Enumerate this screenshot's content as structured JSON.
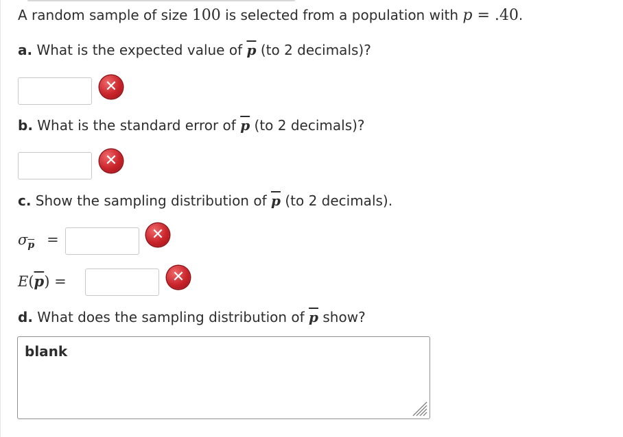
{
  "question": {
    "intro_pre": "A random sample of size ",
    "sample_size": "100",
    "intro_mid": " is selected from a population with ",
    "p_symbol": "p",
    "equals": " = ",
    "p_value": ".40",
    "period": "."
  },
  "part_a": {
    "label": "a.",
    "text_pre": " What is the expected value of ",
    "symbol": "p",
    "text_post": " (to 2 decimals)?"
  },
  "part_b": {
    "label": "b.",
    "text_pre": " What is the standard error of ",
    "symbol": "p",
    "text_post": " (to 2 decimals)?"
  },
  "part_c": {
    "label": "c.",
    "text_pre": " Show the sampling distribution of ",
    "symbol": "p",
    "text_post": " (to 2 decimals)."
  },
  "part_c_rows": {
    "sigma_symbol": "σ",
    "sigma_sub": "p",
    "sigma_eq": "=",
    "expect_E": "E",
    "expect_open": "(",
    "expect_p": "p",
    "expect_close": ")",
    "expect_eq": " ="
  },
  "part_d": {
    "label": "d.",
    "text_pre": " What does the sampling distribution of ",
    "symbol": "p",
    "text_post": " show?"
  },
  "answers": {
    "a_value": "",
    "b_value": "",
    "sigma_value": "",
    "expect_value": "",
    "d_selected": "blank"
  },
  "status_icon": "incorrect-x-icon",
  "status_glyph": "✕",
  "colors": {
    "incorrect": "#c9242b"
  }
}
